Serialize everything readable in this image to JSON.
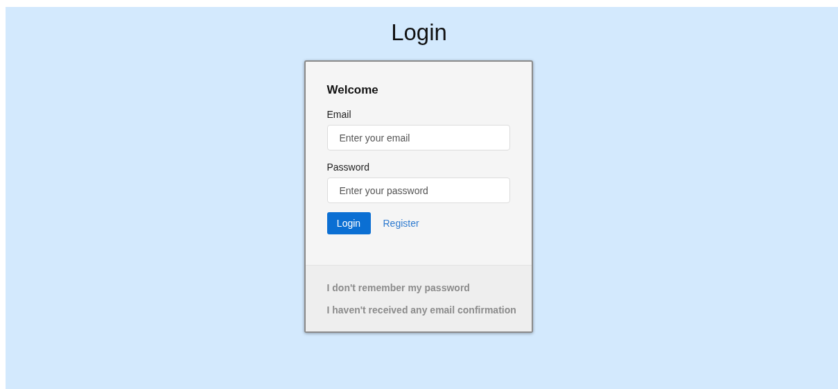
{
  "page": {
    "title": "Login"
  },
  "card": {
    "heading": "Welcome",
    "fields": [
      {
        "label": "Email",
        "placeholder": "Enter your email"
      },
      {
        "label": "Password",
        "placeholder": "Enter your password"
      }
    ],
    "login_button": "Login",
    "register_link": "Register",
    "footer_links": [
      "I don't remember my password",
      "I haven't received any email confirmation"
    ]
  }
}
